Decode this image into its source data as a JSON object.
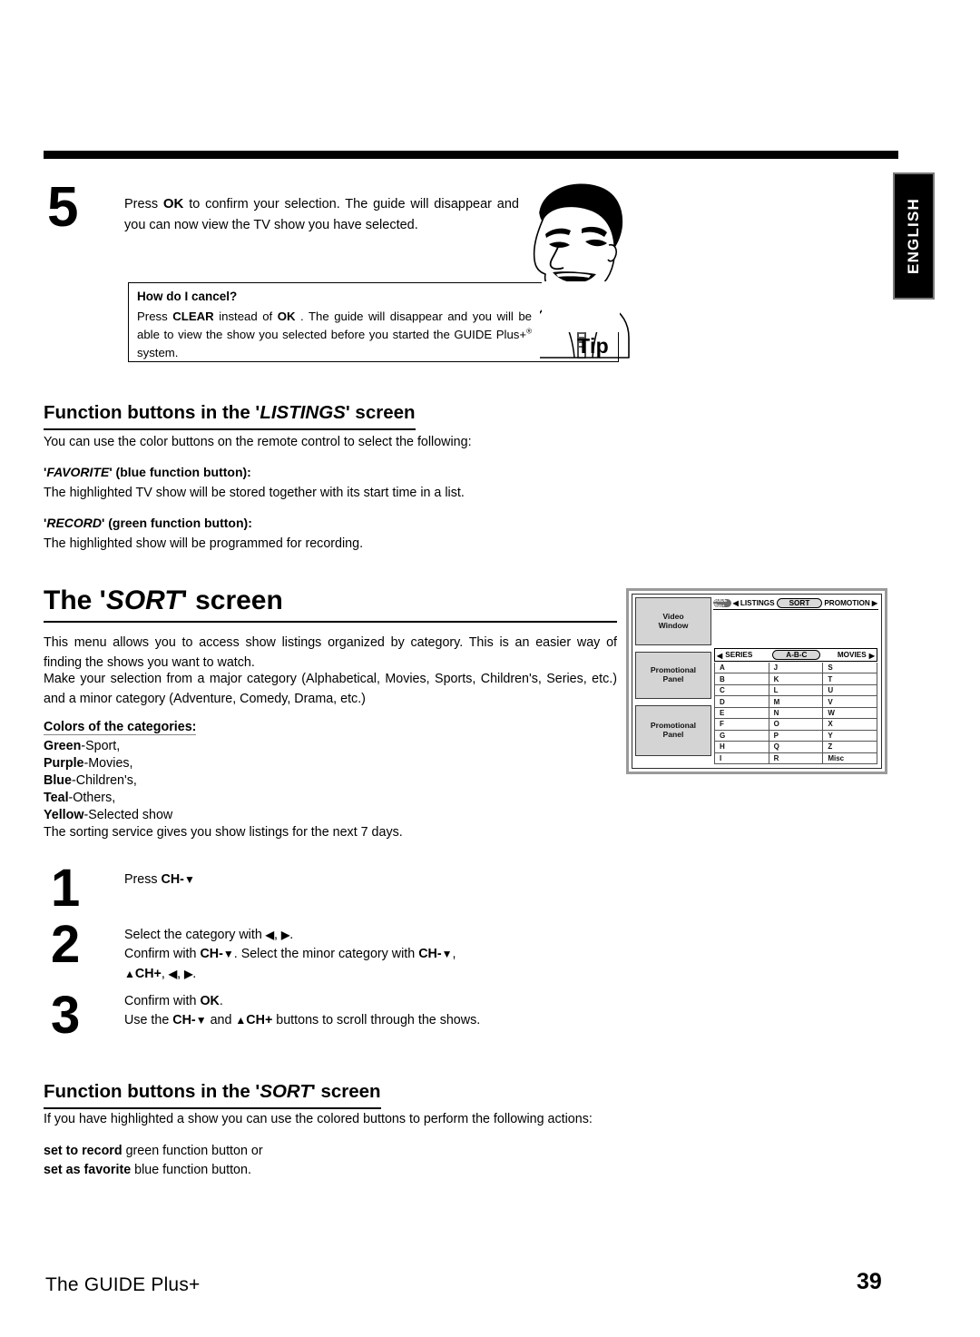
{
  "language_tab": {
    "label": "ENGLISH"
  },
  "step5": {
    "number": "5",
    "text_part1": "Press",
    "key_ok": "OK",
    "text_part2": "to confirm your selection. The guide will disappear and you can now view the TV show you have selected."
  },
  "tip_box": {
    "question": "How do I cancel?",
    "answer_1": "Press",
    "key_clear": "CLEAR",
    "answer_2": "instead of",
    "key_ok": "OK",
    "answer_3": ". The guide will disappear and you will be able to view the show you selected before you started the GUIDE Plus+",
    "registered_mark": "®",
    "answer_4": "system.",
    "tip_word": "Tip",
    "mascot_icon": "cartoon-man-face"
  },
  "listings_section": {
    "heading_prefix": "Function buttons in the '",
    "heading_italic": "LISTINGS",
    "heading_suffix": "' screen",
    "intro": "You can use the color buttons on the remote control to select the following:",
    "items": [
      {
        "label_quote_open": "'",
        "label_italic": "FAVORITE",
        "label_rest": "' (blue function button):",
        "description": "The highlighted TV show will be stored together with its start time in a list."
      },
      {
        "label_quote_open": "'",
        "label_italic": "RECORD",
        "label_rest": "' (green function button):",
        "description": "The highlighted show will be programmed for recording."
      }
    ]
  },
  "sort_section": {
    "heading_prefix": "The '",
    "heading_italic": "SORT",
    "heading_suffix": "' screen",
    "paragraph_1": "This menu allows you to access show listings organized by category. This is an easier way of finding the shows you want to watch.",
    "paragraph_2": "Make your selection from a major category (Alphabetical, Movies, Sports, Children's, Series, etc.) and a minor category (Adventure, Comedy, Drama, etc.)",
    "colors_heading": "Colors of the categories:",
    "colors": [
      {
        "name": "Green",
        "value": "-Sport,"
      },
      {
        "name": "Purple",
        "value": "-Movies,"
      },
      {
        "name": "Blue",
        "value": "-Children's,"
      },
      {
        "name": "Teal",
        "value": "-Others,"
      },
      {
        "name": "Yellow",
        "value": "-Selected show"
      }
    ],
    "closing": "The sorting service gives you show listings for the next 7 days."
  },
  "steps": [
    {
      "number": "1",
      "lines": [
        {
          "pre": "Press",
          "keys": [
            {
              "k": "CH-",
              "arrow": "▼"
            }
          ],
          "post": ""
        }
      ]
    },
    {
      "number": "2",
      "line_1_pre": "Select the category with",
      "line_1_key_left": "◀",
      "line_1_sep": ",",
      "line_1_key_right": "▶",
      "line_1_end": ".",
      "line_2_pre": "Confirm with",
      "line_2_key1": "CH-",
      "line_2_key1_arrow": "▼",
      "line_2_mid": ". Select the minor category with",
      "line_2_key2": "CH-",
      "line_2_key2_arrow": "▼",
      "line_2_end": ",",
      "line_3_key_up": "▲",
      "line_3_key_chplus": "CH+",
      "line_3_sep1": ",",
      "line_3_key_left": "◀",
      "line_3_sep2": ",",
      "line_3_key_right": "▶",
      "line_3_end": "."
    },
    {
      "number": "3",
      "line_1_pre": "Confirm with",
      "line_1_key": "OK",
      "line_1_end": ".",
      "line_2_pre": "Use the",
      "line_2_key1": "CH-",
      "line_2_key1_arrow": "▼",
      "line_2_and": "and",
      "line_2_key2_arrow": "▲",
      "line_2_key2": "CH+",
      "line_2_post": "buttons to scroll through the shows."
    }
  ],
  "sort_buttons_section": {
    "heading_prefix": "Function buttons in the '",
    "heading_italic": "SORT",
    "heading_suffix": "' screen",
    "intro": "If you have highlighted a show you can use the colored buttons to perform the following actions:",
    "actions": [
      {
        "bold": "set to record",
        "rest": "green function button or"
      },
      {
        "bold": "set as favorite",
        "rest": "blue function button."
      }
    ]
  },
  "tv_mockup": {
    "logo_text": "GUIDE Plus+",
    "nav": {
      "left_caret": "◀",
      "right_caret": "▶",
      "items": [
        {
          "label": "LISTINGS",
          "selected": false
        },
        {
          "label": "SORT",
          "selected": true
        },
        {
          "label": "PROMOTION",
          "selected": false
        }
      ]
    },
    "panels": [
      {
        "line1": "Video",
        "line2": "Window"
      },
      {
        "line1": "Promotional",
        "line2": "Panel"
      },
      {
        "line1": "Promotional",
        "line2": "Panel"
      }
    ],
    "category_bar": {
      "left_caret": "◀",
      "left_label": "SERIES",
      "center_label": "A-B-C",
      "right_label": "MOVIES",
      "right_caret": "▶"
    },
    "grid": {
      "columns": [
        [
          "A",
          "B",
          "C",
          "D",
          "E",
          "F",
          "G",
          "H",
          "I"
        ],
        [
          "J",
          "K",
          "L",
          "M",
          "N",
          "O",
          "P",
          "Q",
          "R"
        ],
        [
          "S",
          "T",
          "U",
          "V",
          "W",
          "X",
          "Y",
          "Z",
          "Misc"
        ]
      ]
    }
  },
  "footer": {
    "left_text": "The GUIDE Plus+",
    "page_number": "39"
  }
}
